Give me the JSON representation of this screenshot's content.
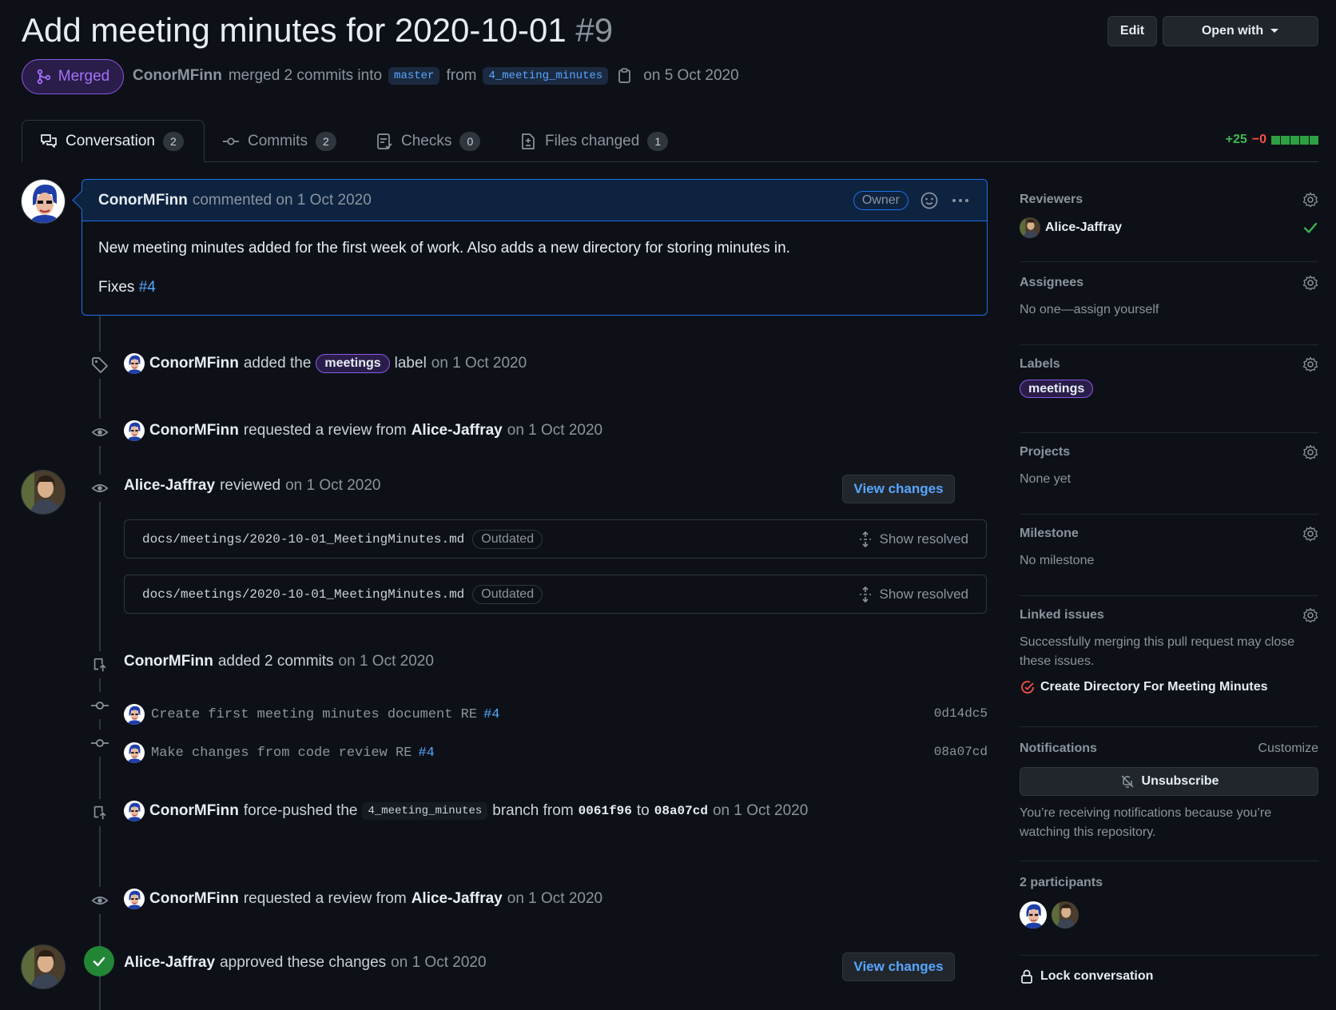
{
  "header": {
    "title": "Add meeting minutes for 2020-10-01",
    "number": "#9",
    "edit_label": "Edit",
    "open_with_label": "Open with"
  },
  "status": {
    "badge": "Merged",
    "author": "ConorMFinn",
    "action": "merged 2 commits into",
    "base_branch": "master",
    "from_word": "from",
    "head_branch": "4_meeting_minutes",
    "date": "on 5 Oct 2020"
  },
  "tabs": [
    {
      "label": "Conversation",
      "count": "2"
    },
    {
      "label": "Commits",
      "count": "2"
    },
    {
      "label": "Checks",
      "count": "0"
    },
    {
      "label": "Files changed",
      "count": "1"
    }
  ],
  "diffstat": {
    "additions": "+25",
    "deletions": "−0",
    "bars": 5
  },
  "comment": {
    "author": "ConorMFinn",
    "meta": "commented on 1 Oct 2020",
    "role": "Owner",
    "body": "New meeting minutes added for the first week of work. Also adds a new directory for storing minutes in.",
    "fixes_word": "Fixes",
    "fixes_ref": "#4"
  },
  "events": {
    "label_added": {
      "author": "ConorMFinn",
      "text1": "added the",
      "label": "meetings",
      "text2": "label",
      "date": "on 1 Oct 2020"
    },
    "review_requested_1": {
      "author": "ConorMFinn",
      "text": "requested a review from",
      "reviewer": "Alice-Jaffray",
      "date": "on 1 Oct 2020"
    },
    "reviewed": {
      "author": "Alice-Jaffray",
      "text": "reviewed",
      "date": "on 1 Oct 2020",
      "button": "View changes"
    },
    "review_files": [
      {
        "path": "docs/meetings/2020-10-01_MeetingMinutes.md",
        "state": "Outdated",
        "action": "Show resolved"
      },
      {
        "path": "docs/meetings/2020-10-01_MeetingMinutes.md",
        "state": "Outdated",
        "action": "Show resolved"
      }
    ],
    "commits_added": {
      "author": "ConorMFinn",
      "text": "added 2 commits",
      "date": "on 1 Oct 2020"
    },
    "commits": [
      {
        "message": "Create first meeting minutes document RE",
        "ref": "#4",
        "sha": "0d14dc5"
      },
      {
        "message": "Make changes from code review RE",
        "ref": "#4",
        "sha": "08a07cd"
      }
    ],
    "force_push": {
      "author": "ConorMFinn",
      "text1": "force-pushed the",
      "branch": "4_meeting_minutes",
      "text2": "branch from",
      "from_sha": "0061f96",
      "to_word": "to",
      "to_sha": "08a07cd",
      "date": "on 1 Oct 2020"
    },
    "review_requested_2": {
      "author": "ConorMFinn",
      "text": "requested a review from",
      "reviewer": "Alice-Jaffray",
      "date": "on 1 Oct 2020"
    },
    "approved": {
      "author": "Alice-Jaffray",
      "text": "approved these changes",
      "date": "on 1 Oct 2020",
      "button": "View changes"
    }
  },
  "sidebar": {
    "reviewers": {
      "title": "Reviewers",
      "name": "Alice-Jaffray"
    },
    "assignees": {
      "title": "Assignees",
      "value": "No one—assign yourself"
    },
    "labels": {
      "title": "Labels",
      "label": "meetings"
    },
    "projects": {
      "title": "Projects",
      "value": "None yet"
    },
    "milestone": {
      "title": "Milestone",
      "value": "No milestone"
    },
    "linked": {
      "title": "Linked issues",
      "desc": "Successfully merging this pull request may close these issues.",
      "issue": "Create Directory For Meeting Minutes"
    },
    "notifications": {
      "title": "Notifications",
      "customize": "Customize",
      "button": "Unsubscribe",
      "desc": "You’re receiving notifications because you’re watching this repository."
    },
    "participants": {
      "title": "2 participants"
    },
    "lock": "Lock conversation"
  },
  "colors": {
    "accent": "#58a6ff",
    "merged": "#a371f7",
    "added": "#3fb950",
    "removed": "#f85149",
    "approved": "#238636"
  }
}
